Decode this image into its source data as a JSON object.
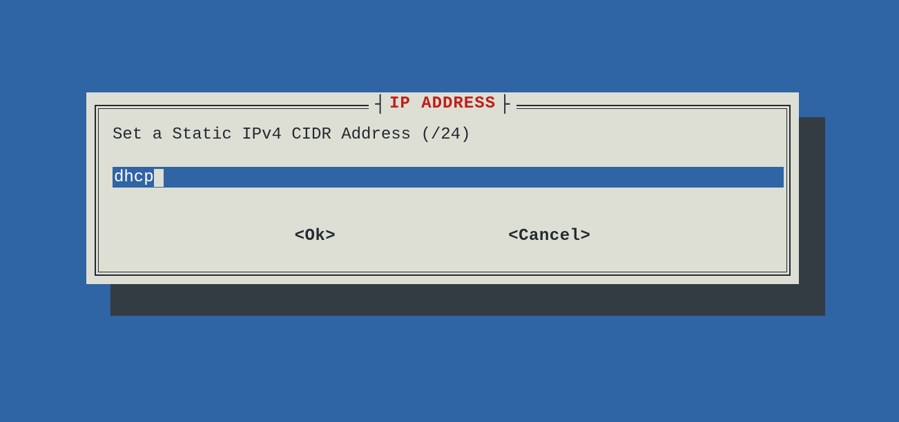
{
  "dialog": {
    "title": "IP ADDRESS",
    "prompt": "Set a Static IPv4 CIDR Address (/24)",
    "input": {
      "value": "dhcp"
    },
    "buttons": {
      "ok": "<Ok>",
      "cancel": "<Cancel>"
    }
  },
  "colors": {
    "background": "#2f64a5",
    "panel": "#dddfd5",
    "shadow": "#333b43",
    "title": "#c11e1a",
    "frame": "#232a30",
    "input_bg": "#2f64a5",
    "input_fg": "#ffffff"
  }
}
